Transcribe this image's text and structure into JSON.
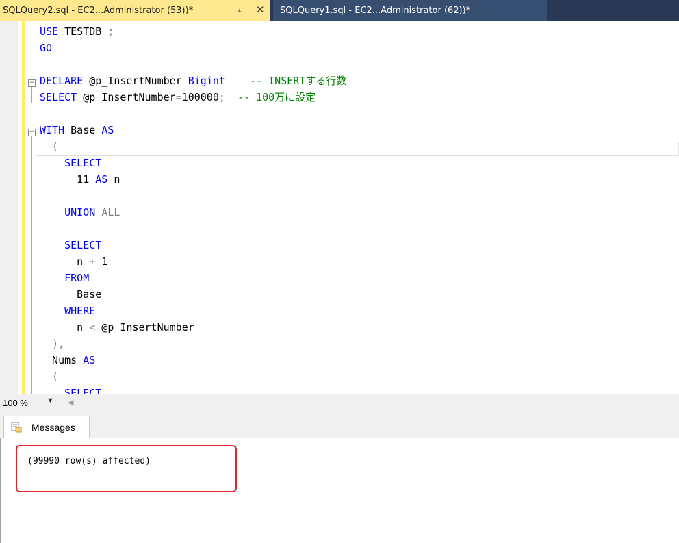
{
  "tabs": {
    "active": {
      "title": "SQLQuery2.sql - EC2...Administrator (53))*",
      "pin_icon": "pin-icon",
      "close_icon": "close-icon"
    },
    "inactive": {
      "title": "SQLQuery1.sql - EC2...Administrator (62))*"
    }
  },
  "editor": {
    "lines": [
      {
        "parts": [
          [
            "kw",
            "USE"
          ],
          [
            "pl",
            " TESTDB "
          ],
          [
            "gr",
            ";"
          ]
        ]
      },
      {
        "parts": [
          [
            "kw",
            "GO"
          ]
        ]
      },
      {
        "parts": []
      },
      {
        "parts": [
          [
            "kw",
            "DECLARE"
          ],
          [
            "pl",
            " @p_InsertNumber "
          ],
          [
            "kw",
            "Bigint"
          ],
          [
            "pl",
            "    "
          ],
          [
            "cm",
            "-- INSERTする行数"
          ]
        ]
      },
      {
        "parts": [
          [
            "kw",
            "SELECT"
          ],
          [
            "pl",
            " @p_InsertNumber"
          ],
          [
            "gr",
            "="
          ],
          [
            "pl",
            "100000"
          ],
          [
            "gr",
            ";"
          ],
          [
            "pl",
            "  "
          ],
          [
            "cm",
            "-- 100万に設定"
          ]
        ]
      },
      {
        "parts": []
      },
      {
        "parts": [
          [
            "kw",
            "WITH"
          ],
          [
            "pl",
            " Base "
          ],
          [
            "kw",
            "AS"
          ]
        ]
      },
      {
        "parts": [
          [
            "pl",
            "  "
          ],
          [
            "gr",
            "("
          ]
        ]
      },
      {
        "parts": [
          [
            "pl",
            "    "
          ],
          [
            "kw",
            "SELECT"
          ]
        ]
      },
      {
        "parts": [
          [
            "pl",
            "      11 "
          ],
          [
            "kw",
            "AS"
          ],
          [
            "pl",
            " n"
          ]
        ]
      },
      {
        "parts": []
      },
      {
        "parts": [
          [
            "pl",
            "    "
          ],
          [
            "kw",
            "UNION"
          ],
          [
            "pl",
            " "
          ],
          [
            "gr",
            "ALL"
          ]
        ]
      },
      {
        "parts": []
      },
      {
        "parts": [
          [
            "pl",
            "    "
          ],
          [
            "kw",
            "SELECT"
          ]
        ]
      },
      {
        "parts": [
          [
            "pl",
            "      n "
          ],
          [
            "gr",
            "+"
          ],
          [
            "pl",
            " 1"
          ]
        ]
      },
      {
        "parts": [
          [
            "pl",
            "    "
          ],
          [
            "kw",
            "FROM"
          ]
        ]
      },
      {
        "parts": [
          [
            "pl",
            "      Base"
          ]
        ]
      },
      {
        "parts": [
          [
            "pl",
            "    "
          ],
          [
            "kw",
            "WHERE"
          ]
        ]
      },
      {
        "parts": [
          [
            "pl",
            "      n "
          ],
          [
            "gr",
            "<"
          ],
          [
            "pl",
            " @p_InsertNumber"
          ]
        ]
      },
      {
        "parts": [
          [
            "pl",
            "  "
          ],
          [
            "gr",
            "),"
          ]
        ]
      },
      {
        "parts": [
          [
            "pl",
            "  Nums "
          ],
          [
            "kw",
            "AS"
          ]
        ]
      },
      {
        "parts": [
          [
            "pl",
            "  "
          ],
          [
            "gr",
            "("
          ]
        ]
      },
      {
        "parts": [
          [
            "pl",
            "    "
          ],
          [
            "kw",
            "SELECT"
          ]
        ]
      }
    ]
  },
  "statusbar": {
    "zoom": "100 %"
  },
  "results": {
    "tab_label": "Messages",
    "tab_icon": "messages-icon",
    "message": "(99990 row(s) affected)"
  },
  "colors": {
    "keyword": "#0000ff",
    "comment": "#008000",
    "operator": "#808080",
    "active_tab": "#ffe98f",
    "tabstrip": "#293955",
    "highlight_border": "#e8232c"
  }
}
